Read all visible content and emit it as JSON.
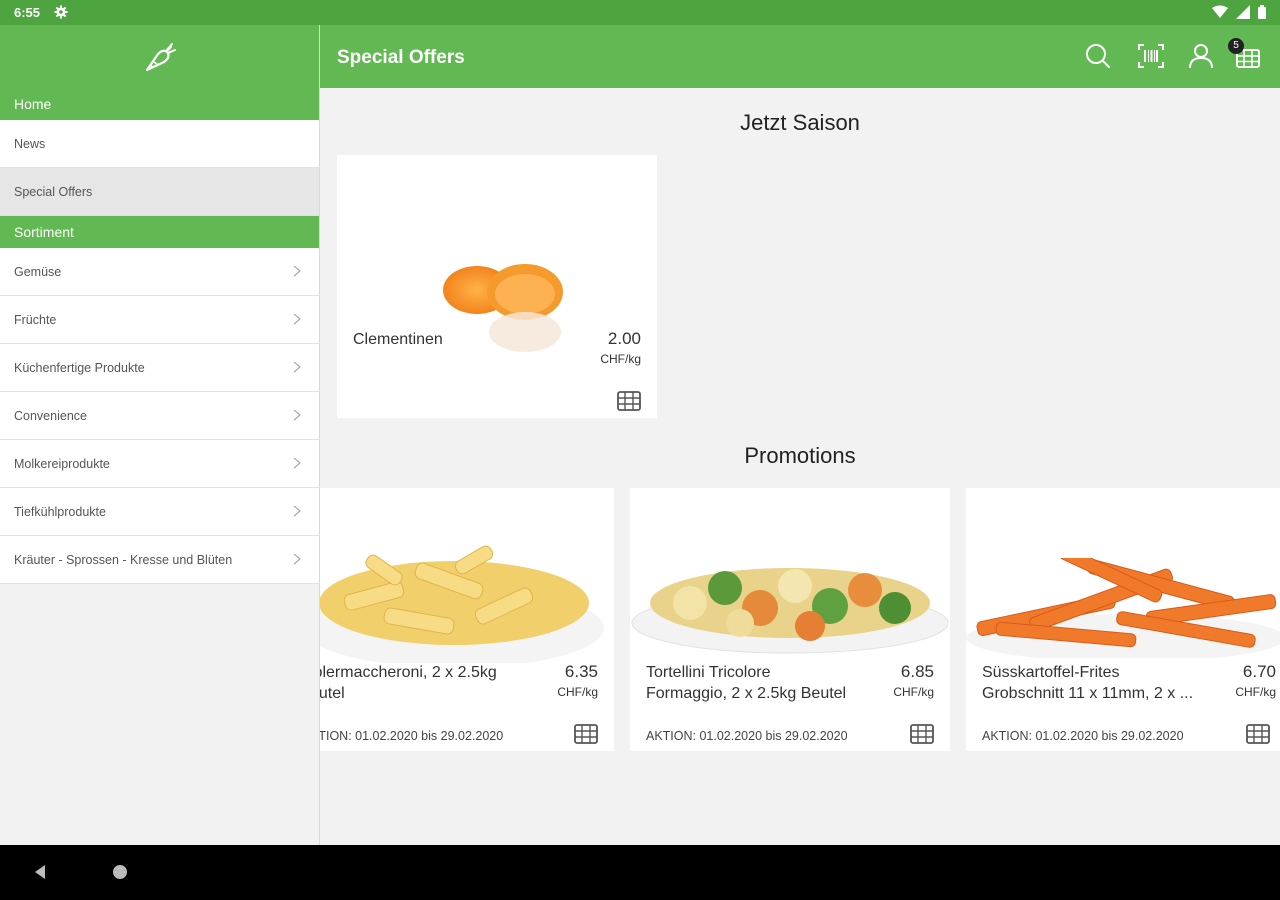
{
  "status_bar": {
    "time": "6:55"
  },
  "app_bar": {
    "title": "Special Offers",
    "cart_count": "5"
  },
  "sidebar": {
    "home_header": "Home",
    "home_items": [
      {
        "label": "News"
      },
      {
        "label": "Special Offers"
      }
    ],
    "sortiment_header": "Sortiment",
    "sortiment_items": [
      {
        "label": "Gemüse"
      },
      {
        "label": "Früchte"
      },
      {
        "label": "Küchenfertige Produkte"
      },
      {
        "label": "Convenience"
      },
      {
        "label": "Molkereiprodukte"
      },
      {
        "label": "Tiefkühlprodukte"
      },
      {
        "label": "Kräuter - Sprossen - Kresse und Blüten"
      }
    ]
  },
  "content": {
    "season_title": "Jetzt Saison",
    "season_products": [
      {
        "name": "Clementinen",
        "price": "2.00",
        "unit": "CHF/kg"
      }
    ],
    "promotions_title": "Promotions",
    "promotions": [
      {
        "name_line1": "lplermaccheroni, 2 x 2.5kg",
        "name_line2": "eutel",
        "price": "6.35",
        "unit": "CHF/kg",
        "promo": "KTION: 01.02.2020 bis 29.02.2020"
      },
      {
        "name_line1": "Tortellini Tricolore",
        "name_line2": "Formaggio, 2 x 2.5kg Beutel",
        "price": "6.85",
        "unit": "CHF/kg",
        "promo": "AKTION: 01.02.2020 bis 29.02.2020"
      },
      {
        "name_line1": "Süsskartoffel-Frites",
        "name_line2": "Grobschnitt 11 x 11mm, 2 x ...",
        "price": "6.70",
        "unit": "CHF/kg",
        "promo": "AKTION: 01.02.2020 bis 29.02.2020"
      }
    ]
  },
  "colors": {
    "brand_green": "#62b852",
    "status_green": "#4ea43f"
  }
}
